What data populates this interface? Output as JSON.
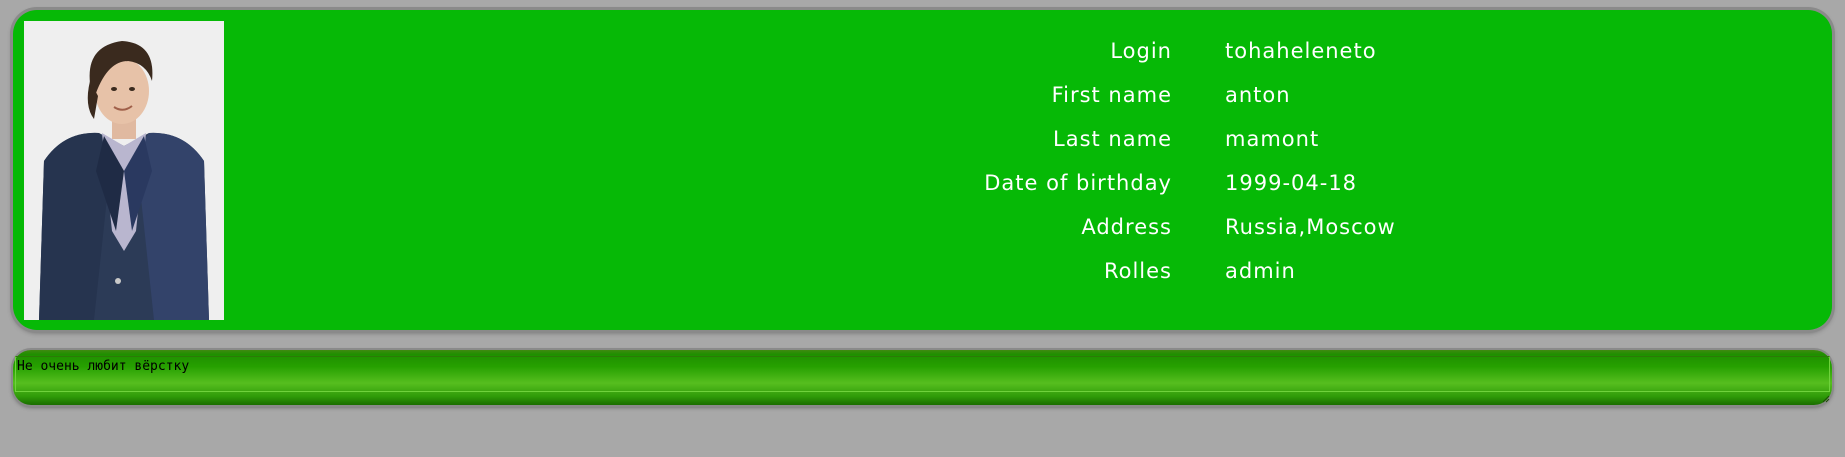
{
  "profile": {
    "avatar_icon": "user-photo",
    "fields": [
      {
        "label": "Login",
        "value": "tohaheleneto"
      },
      {
        "label": "First name",
        "value": "anton"
      },
      {
        "label": "Last name",
        "value": "mamont"
      },
      {
        "label": "Date of birthday",
        "value": "1999-04-18"
      },
      {
        "label": "Address",
        "value": "Russia,Moscow"
      },
      {
        "label": "Rolles",
        "value": "admin"
      }
    ]
  },
  "note": {
    "value": "Не очень любит вёрстку"
  },
  "colors": {
    "background": "#a8a8a8",
    "card": "#06b906",
    "text": "#ffffff"
  }
}
